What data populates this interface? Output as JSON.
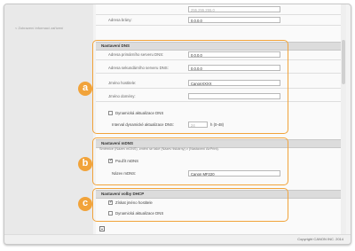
{
  "nav": {
    "link": "< Zobrazení informací zařízení"
  },
  "top": {
    "row1_value": "255.255.255.0",
    "gateway_label": "Adresa brány:",
    "gateway_value": "0.0.0.0"
  },
  "dns": {
    "title": "Nastavení DNS",
    "primary_label": "Adresa primárního serveru DNS:",
    "primary_value": "0.0.0.0",
    "secondary_label": "Adresa sekundárního serveru DNS:",
    "secondary_value": "0.0.0.0",
    "hostname_label": "Jméno hostitele:",
    "hostname_value": "CanonXXXX",
    "domain_label": "Jméno domény:",
    "domain_value": "",
    "dyn_update_label": "Dynamická aktualizace DNS",
    "interval_label": "Interval dynamické aktualizace DNS:",
    "interval_value": "24",
    "interval_unit": "h (0-48)"
  },
  "mdns": {
    "title": "Nastavení mDNS",
    "note": "Směrnice (Název mDNS), změní se také (Název tiskárny) v (Nastavení AirPrint).",
    "use_label": "Použít mDNS",
    "name_label": "Název mDNS:",
    "name_value": "Canon MF220"
  },
  "dhcp": {
    "title": "Nastavení volby DHCP",
    "hostname_label": "Získat jméno hostitele",
    "dyn_label": "Dynamická aktualizace DNS"
  },
  "callouts": {
    "a": "a",
    "b": "b",
    "c": "c"
  },
  "footer": {
    "copyright": "Copyright CANON INC. 2014"
  },
  "colors": {
    "accent": "#f1a33a"
  }
}
